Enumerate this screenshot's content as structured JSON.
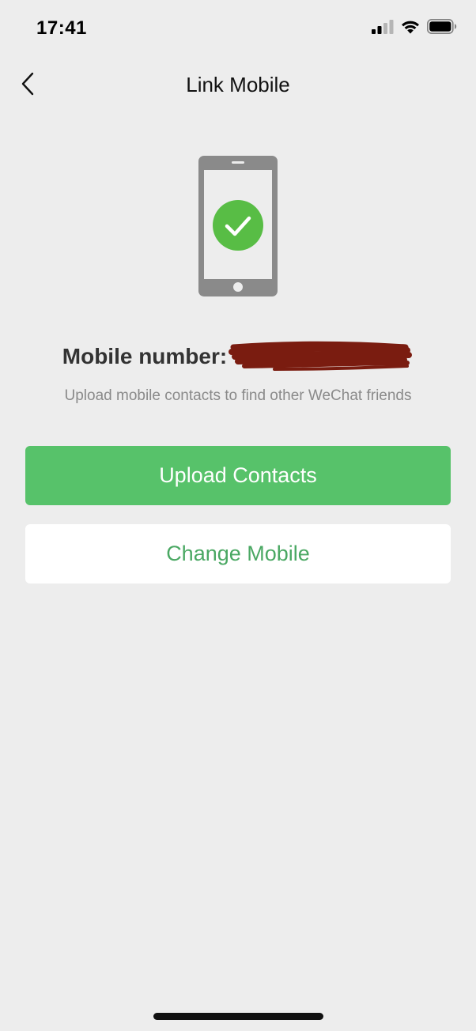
{
  "status_bar": {
    "time": "17:41",
    "icons": [
      "cellular-signal-icon",
      "wifi-icon",
      "battery-icon"
    ]
  },
  "nav": {
    "back_icon": "chevron-left-icon",
    "title": "Link Mobile"
  },
  "illustration": {
    "icon": "phone-check-icon",
    "phone_color": "#8a8a8a",
    "check_color": "#58bd45"
  },
  "mobile": {
    "label": "Mobile number:",
    "redaction_color": "#7a1c10"
  },
  "subtitle": "Upload mobile contacts to find other WeChat friends",
  "buttons": {
    "upload_label": "Upload Contacts",
    "change_label": "Change Mobile"
  },
  "colors": {
    "background": "#ededed",
    "primary_green": "#57c26a",
    "secondary_text_green": "#4aa863"
  }
}
